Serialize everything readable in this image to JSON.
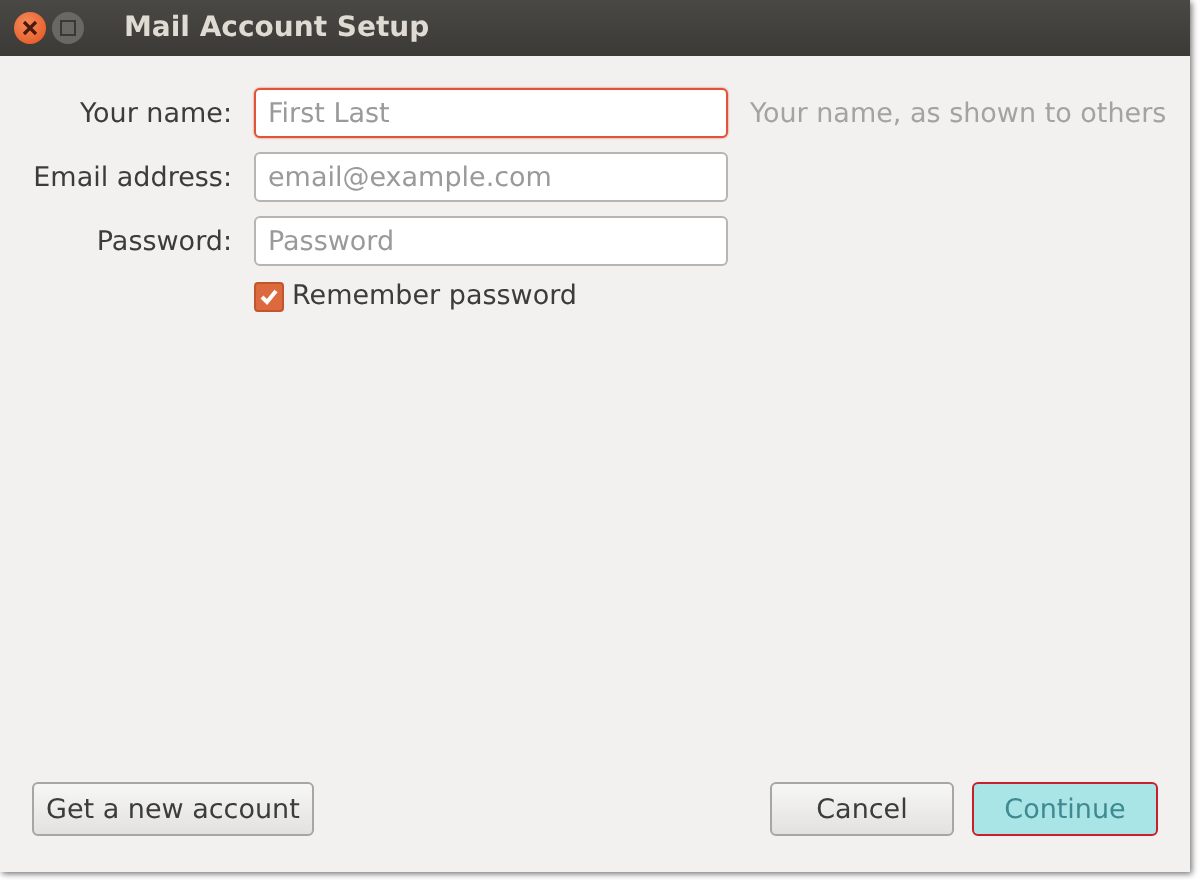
{
  "window": {
    "title": "Mail Account Setup"
  },
  "fields": [
    {
      "label": "Your name:",
      "placeholder": "First Last",
      "hint": "Your name, as shown to others",
      "focused": true
    },
    {
      "label": "Email address:",
      "placeholder": "email@example.com",
      "focused": false
    },
    {
      "label": "Password:",
      "placeholder": "Password",
      "focused": false
    }
  ],
  "remember": {
    "label": "Remember password",
    "checked": true
  },
  "buttons": {
    "new_account": {
      "label": "Get a new account"
    },
    "cancel": {
      "label": "Cancel"
    },
    "continue": {
      "label": "Continue",
      "disabled": true
    }
  }
}
